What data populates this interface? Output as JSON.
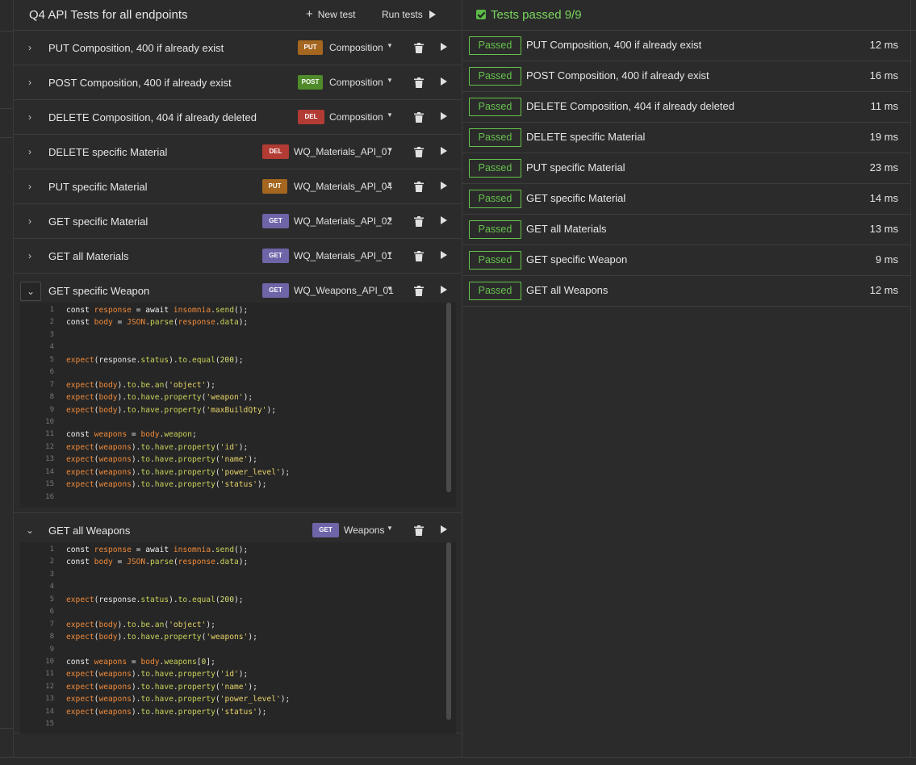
{
  "header": {
    "title": "Q4 API Tests for all endpoints",
    "new_test_label": "New test",
    "run_tests_label": "Run tests"
  },
  "tests": [
    {
      "name": "PUT Composition, 400 if already exist",
      "method": "PUT",
      "request": "Composition",
      "expanded": false
    },
    {
      "name": "POST Composition, 400 if already exist",
      "method": "POST",
      "request": "Composition",
      "expanded": false
    },
    {
      "name": "DELETE Composition, 404 if already deleted",
      "method": "DEL",
      "request": "Composition",
      "expanded": false
    },
    {
      "name": "DELETE specific Material",
      "method": "DEL",
      "request": "WQ_Materials_API_07",
      "expanded": false
    },
    {
      "name": "PUT specific Material",
      "method": "PUT",
      "request": "WQ_Materials_API_04",
      "expanded": false
    },
    {
      "name": "GET specific Material",
      "method": "GET",
      "request": "WQ_Materials_API_02",
      "expanded": false
    },
    {
      "name": "GET all Materials",
      "method": "GET",
      "request": "WQ_Materials_API_01",
      "expanded": false
    },
    {
      "name": "GET specific Weapon",
      "method": "GET",
      "request": "WQ_Weapons_API_01",
      "expanded": true
    },
    {
      "name": "GET all Weapons",
      "method": "GET",
      "request": "Weapons",
      "expanded": true
    }
  ],
  "editor_weapon": [
    "const response = await insomnia.send();",
    "const body = JSON.parse(response.data);",
    "",
    "",
    "expect(response.status).to.equal(200);",
    "",
    "expect(body).to.be.an('object');",
    "expect(body).to.have.property('weapon');",
    "expect(body).to.have.property('maxBuildQty');",
    "",
    "const weapons = body.weapon;",
    "expect(weapons).to.have.property('id');",
    "expect(weapons).to.have.property('name');",
    "expect(weapons).to.have.property('power_level');",
    "expect(weapons).to.have.property('status');",
    ""
  ],
  "editor_weapons": [
    "const response = await insomnia.send();",
    "const body = JSON.parse(response.data);",
    "",
    "",
    "expect(response.status).to.equal(200);",
    "",
    "expect(body).to.be.an('object');",
    "expect(body).to.have.property('weapons');",
    "",
    "const weapons = body.weapons[0];",
    "expect(weapons).to.have.property('id');",
    "expect(weapons).to.have.property('name');",
    "expect(weapons).to.have.property('power_level');",
    "expect(weapons).to.have.property('status');",
    ""
  ],
  "results": {
    "title": "Tests passed  9/9",
    "items": [
      {
        "status": "Passed",
        "name": "PUT Composition, 400 if already exist",
        "time": "12 ms"
      },
      {
        "status": "Passed",
        "name": "POST Composition, 400 if already exist",
        "time": "16 ms"
      },
      {
        "status": "Passed",
        "name": "DELETE Composition, 404 if already deleted",
        "time": "11 ms"
      },
      {
        "status": "Passed",
        "name": "DELETE specific Material",
        "time": "19 ms"
      },
      {
        "status": "Passed",
        "name": "PUT specific Material",
        "time": "23 ms"
      },
      {
        "status": "Passed",
        "name": "GET specific Material",
        "time": "14 ms"
      },
      {
        "status": "Passed",
        "name": "GET all Materials",
        "time": "13 ms"
      },
      {
        "status": "Passed",
        "name": "GET specific Weapon",
        "time": "9 ms"
      },
      {
        "status": "Passed",
        "name": "GET all Weapons",
        "time": "12 ms"
      }
    ]
  },
  "colors": {
    "put": "#a5661f",
    "post": "#4f8a2b",
    "del": "#b23b34",
    "get": "#6e64a8",
    "passed": "#66c24e"
  }
}
